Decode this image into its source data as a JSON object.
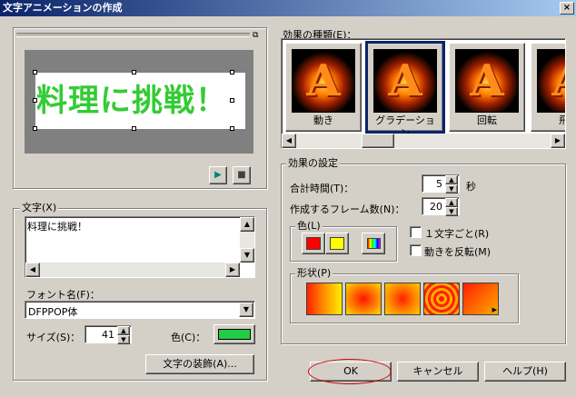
{
  "window": {
    "title": "文字アニメーションの作成",
    "close_glyph": "×"
  },
  "preview": {
    "text": "料理に挑戦！",
    "text_color": "#33cc33",
    "play_glyph": "▶",
    "stop_glyph": "■"
  },
  "text_group": {
    "label": "文字(X)",
    "value": "料理に挑戦！"
  },
  "font": {
    "label": "フォント名(F)：",
    "value": "DFPPOP体"
  },
  "size": {
    "label": "サイズ(S)：",
    "value": "41"
  },
  "text_color": {
    "label": "色(C)：",
    "value": "#22cc44"
  },
  "decoration_button": "文字の装飾(A)...",
  "effects": {
    "label": "効果の種類(E)：",
    "items": [
      {
        "label": "動き",
        "selected": false
      },
      {
        "label": "グラデーション",
        "selected": true
      },
      {
        "label": "回転",
        "selected": false
      },
      {
        "label": "飛び",
        "selected": false
      }
    ],
    "glyph": "A"
  },
  "settings": {
    "label": "効果の設定",
    "total_time": {
      "label": "合計時間(T)：",
      "value": "5",
      "unit": "秒"
    },
    "frames": {
      "label": "作成するフレーム数(N)：",
      "value": "20"
    },
    "color_group": {
      "label": "色(L)",
      "swatches": [
        "#ff0000",
        "#ffff00"
      ]
    },
    "per_char": {
      "label": "１文字ごと(R)",
      "checked": false
    },
    "reverse": {
      "label": "動きを反転(M)",
      "checked": false
    },
    "shape_group": {
      "label": "形状(P)"
    }
  },
  "buttons": {
    "ok": "OK",
    "cancel": "キャンセル",
    "help": "ヘルプ(H)"
  },
  "colors": {
    "dialog_bg": "#d4d0c8",
    "title_start": "#0a246a",
    "title_end": "#a6caf0",
    "selection_border": "#0a246a",
    "ok_highlight": "#cc0000"
  }
}
